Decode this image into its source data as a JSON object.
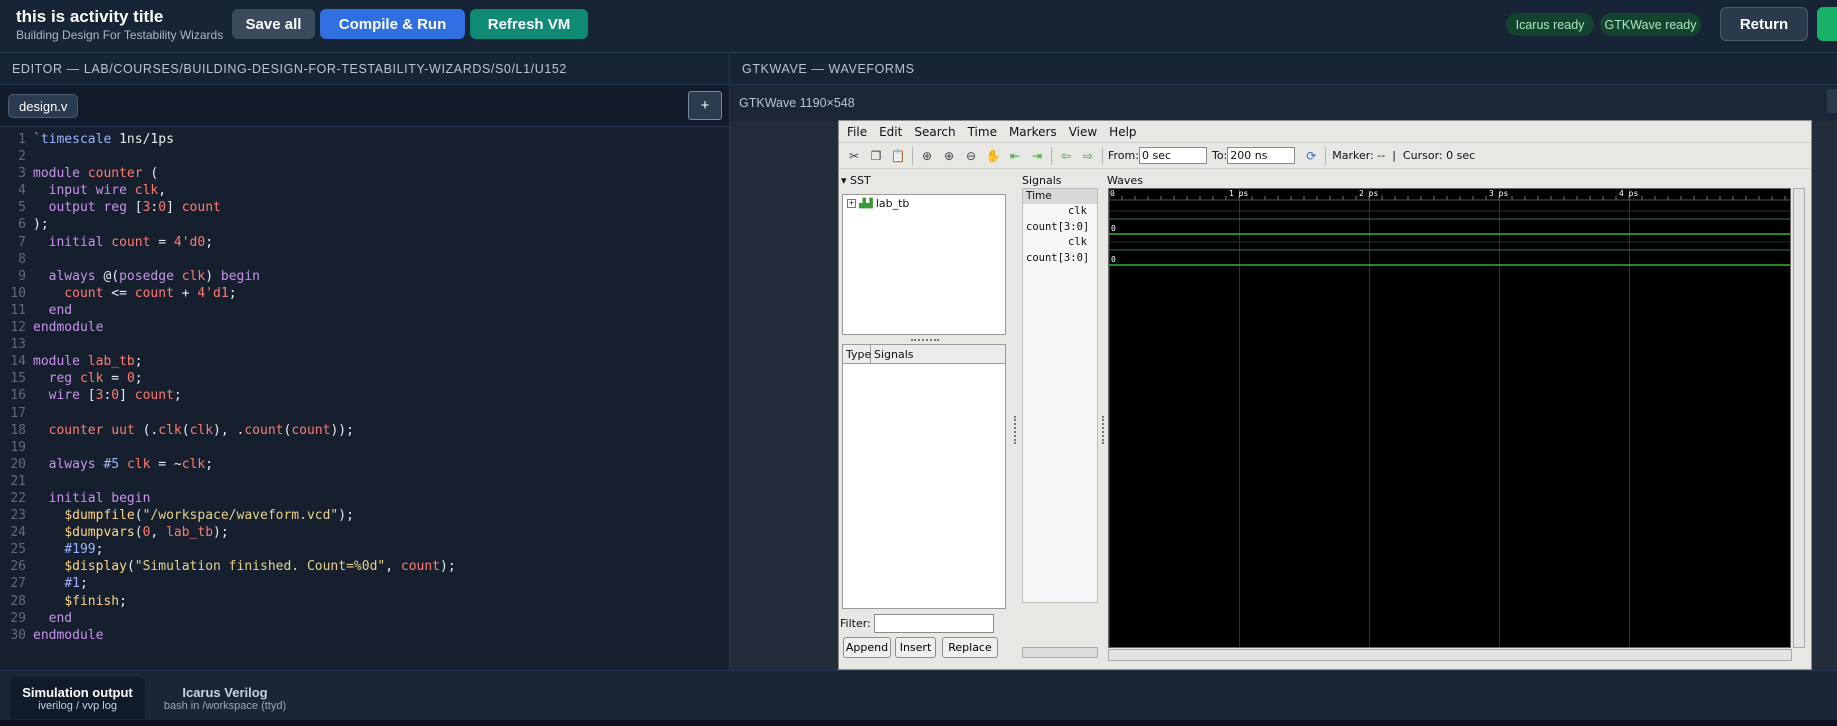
{
  "header": {
    "title": "this is activity title",
    "subtitle": "Building Design For Testability Wizards",
    "save_label": "Save all",
    "compile_label": "Compile & Run",
    "refresh_label": "Refresh VM",
    "icarus_status": "Icarus ready",
    "gtkwave_status": "GTKWave ready",
    "return_label": "Return"
  },
  "editor": {
    "heading": "EDITOR — LAB/COURSES/BUILDING-DESIGN-FOR-TESTABILITY-WIZARDS/S0/L1/U152",
    "file_tab": "design.v",
    "add_label": "+",
    "lines": [
      "`timescale 1ns/1ps",
      "",
      "module counter (",
      "  input wire clk,",
      "  output reg [3:0] count",
      ");",
      "  initial count = 4'd0;",
      "",
      "  always @(posedge clk) begin",
      "    count <= count + 4'd1;",
      "  end",
      "endmodule",
      "",
      "module lab_tb;",
      "  reg clk = 0;",
      "  wire [3:0] count;",
      "",
      "  counter uut (.clk(clk), .count(count));",
      "",
      "  always #5 clk = ~clk;",
      "",
      "  initial begin",
      "    $dumpfile(\"/workspace/waveform.vcd\");",
      "    $dumpvars(0, lab_tb);",
      "    #199;",
      "    $display(\"Simulation finished. Count=%0d\", count);",
      "    #1;",
      "    $finish;",
      "  end",
      "endmodule"
    ]
  },
  "gtkwave": {
    "heading": "GTKWAVE — WAVEFORMS",
    "window_label": "GTKWave 1190×548",
    "menu": [
      "File",
      "Edit",
      "Search",
      "Time",
      "Markers",
      "View",
      "Help"
    ],
    "from_label": "From:",
    "from_value": "0 sec",
    "to_label": "To:",
    "to_value": "200 ns",
    "marker_text": "Marker: --  |  Cursor: 0 sec",
    "sst_label": "SST",
    "tree_item": "lab_tb",
    "type_col": "Type",
    "signals_col": "Signals",
    "filter_label": "Filter:",
    "append_label": "Append",
    "insert_label": "Insert",
    "replace_label": "Replace",
    "signals_label": "Signals",
    "time_label": "Time",
    "signals": [
      "clk",
      "count[3:0]",
      "clk",
      "count[3:0]"
    ],
    "waves_label": "Waves",
    "time_ticks": [
      "0",
      "1 ps",
      "2 ps",
      "3 ps",
      "4 ps"
    ],
    "bus_values": [
      "0",
      "0"
    ]
  },
  "bottom": {
    "tab1_title": "Simulation output",
    "tab1_sub": "iverilog / vvp log",
    "tab2_title": "Icarus Verilog",
    "tab2_sub": "bash in /workspace (ttyd)"
  }
}
